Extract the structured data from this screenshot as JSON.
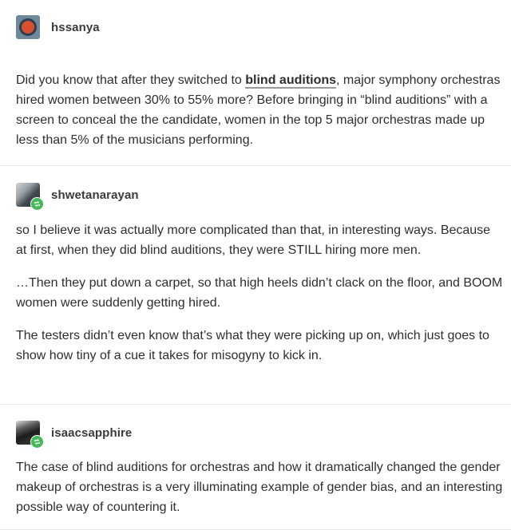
{
  "posts": [
    {
      "username": "hssanya",
      "paragraphs": [
        {
          "before": "Did you know that after they switched to ",
          "link": "blind auditions",
          "after": ", major symphony orchestras hired women between 30% to 55% more? Before bringing in “blind auditions” with a screen to conceal the the candidate, women in the top 5 major orchestras made up less than 5% of the musicians performing."
        }
      ]
    },
    {
      "username": "shwetanarayan",
      "paragraphs": [
        "so I believe it was actually more complicated than that, in interesting ways. Because at first, when they did blind auditions, they were STILL hiring more men.",
        "…Then they put down a carpet, so that high heels didn’t clack on the floor,  and BOOM women were suddenly getting hired.",
        "The testers didn’t even know that’s what they were picking up on, which just goes to show how tiny of a cue it takes for misogyny to kick in."
      ]
    },
    {
      "username": "isaacsapphire",
      "paragraphs": [
        "The case of blind auditions for orchestras and how it dramatically changed the gender makeup of orchestras is a very illuminating example of gender bias, and an interesting possible way of countering it."
      ]
    }
  ],
  "colors": {
    "text": "#2e2e2e",
    "username": "#3a3a3a",
    "divider": "#e6e6e6",
    "reblog_badge": "#47b85a",
    "avatar_1_accent": "#d8512f"
  },
  "icons": {
    "reblog_badge": "reblog-icon"
  }
}
